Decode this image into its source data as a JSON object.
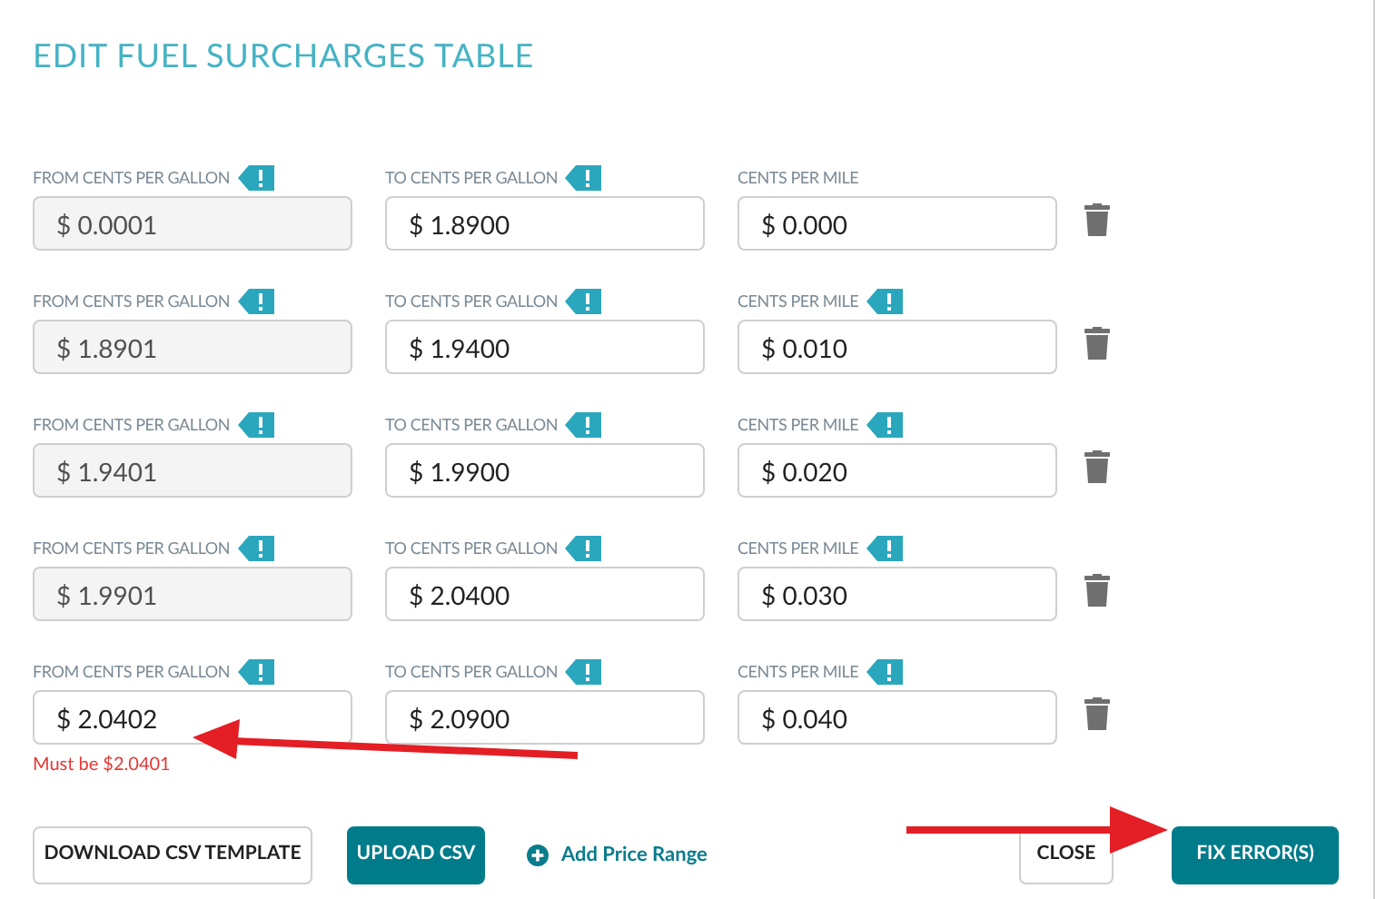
{
  "title": "EDIT FUEL SURCHARGES TABLE",
  "rows": [
    {
      "from": {
        "label": "FROM CENTS PER GALLON",
        "hint": true,
        "value": "$ 0.0001",
        "disabled": true
      },
      "to": {
        "label": "TO CENTS PER GALLON",
        "hint": true,
        "value": "$ 1.8900",
        "disabled": false
      },
      "cpm": {
        "label": "CENTS PER MILE",
        "hint": false,
        "value": "$ 0.000",
        "disabled": false
      }
    },
    {
      "from": {
        "label": "FROM CENTS PER GALLON",
        "hint": true,
        "value": "$ 1.8901",
        "disabled": true
      },
      "to": {
        "label": "TO CENTS PER GALLON",
        "hint": true,
        "value": "$ 1.9400",
        "disabled": false
      },
      "cpm": {
        "label": "CENTS PER MILE",
        "hint": true,
        "value": "$ 0.010",
        "disabled": false
      }
    },
    {
      "from": {
        "label": "FROM CENTS PER GALLON",
        "hint": true,
        "value": "$ 1.9401",
        "disabled": true
      },
      "to": {
        "label": "TO CENTS PER GALLON",
        "hint": true,
        "value": "$ 1.9900",
        "disabled": false
      },
      "cpm": {
        "label": "CENTS PER MILE",
        "hint": true,
        "value": "$ 0.020",
        "disabled": false
      }
    },
    {
      "from": {
        "label": "FROM CENTS PER GALLON",
        "hint": true,
        "value": "$ 1.9901",
        "disabled": true
      },
      "to": {
        "label": "TO CENTS PER GALLON",
        "hint": true,
        "value": "$ 2.0400",
        "disabled": false
      },
      "cpm": {
        "label": "CENTS PER MILE",
        "hint": true,
        "value": "$ 0.030",
        "disabled": false
      }
    },
    {
      "from": {
        "label": "FROM CENTS PER GALLON",
        "hint": true,
        "value": "$ 2.0402",
        "disabled": false,
        "error": "Must be $2.0401"
      },
      "to": {
        "label": "TO CENTS PER GALLON",
        "hint": true,
        "value": "$ 2.0900",
        "disabled": false
      },
      "cpm": {
        "label": "CENTS PER MILE",
        "hint": true,
        "value": "$ 0.040",
        "disabled": false
      }
    }
  ],
  "buttons": {
    "download": "DOWNLOAD CSV TEMPLATE",
    "upload": "UPLOAD CSV",
    "add": "Add Price Range",
    "close": "CLOSE",
    "fix": "FIX ERROR(S)"
  }
}
